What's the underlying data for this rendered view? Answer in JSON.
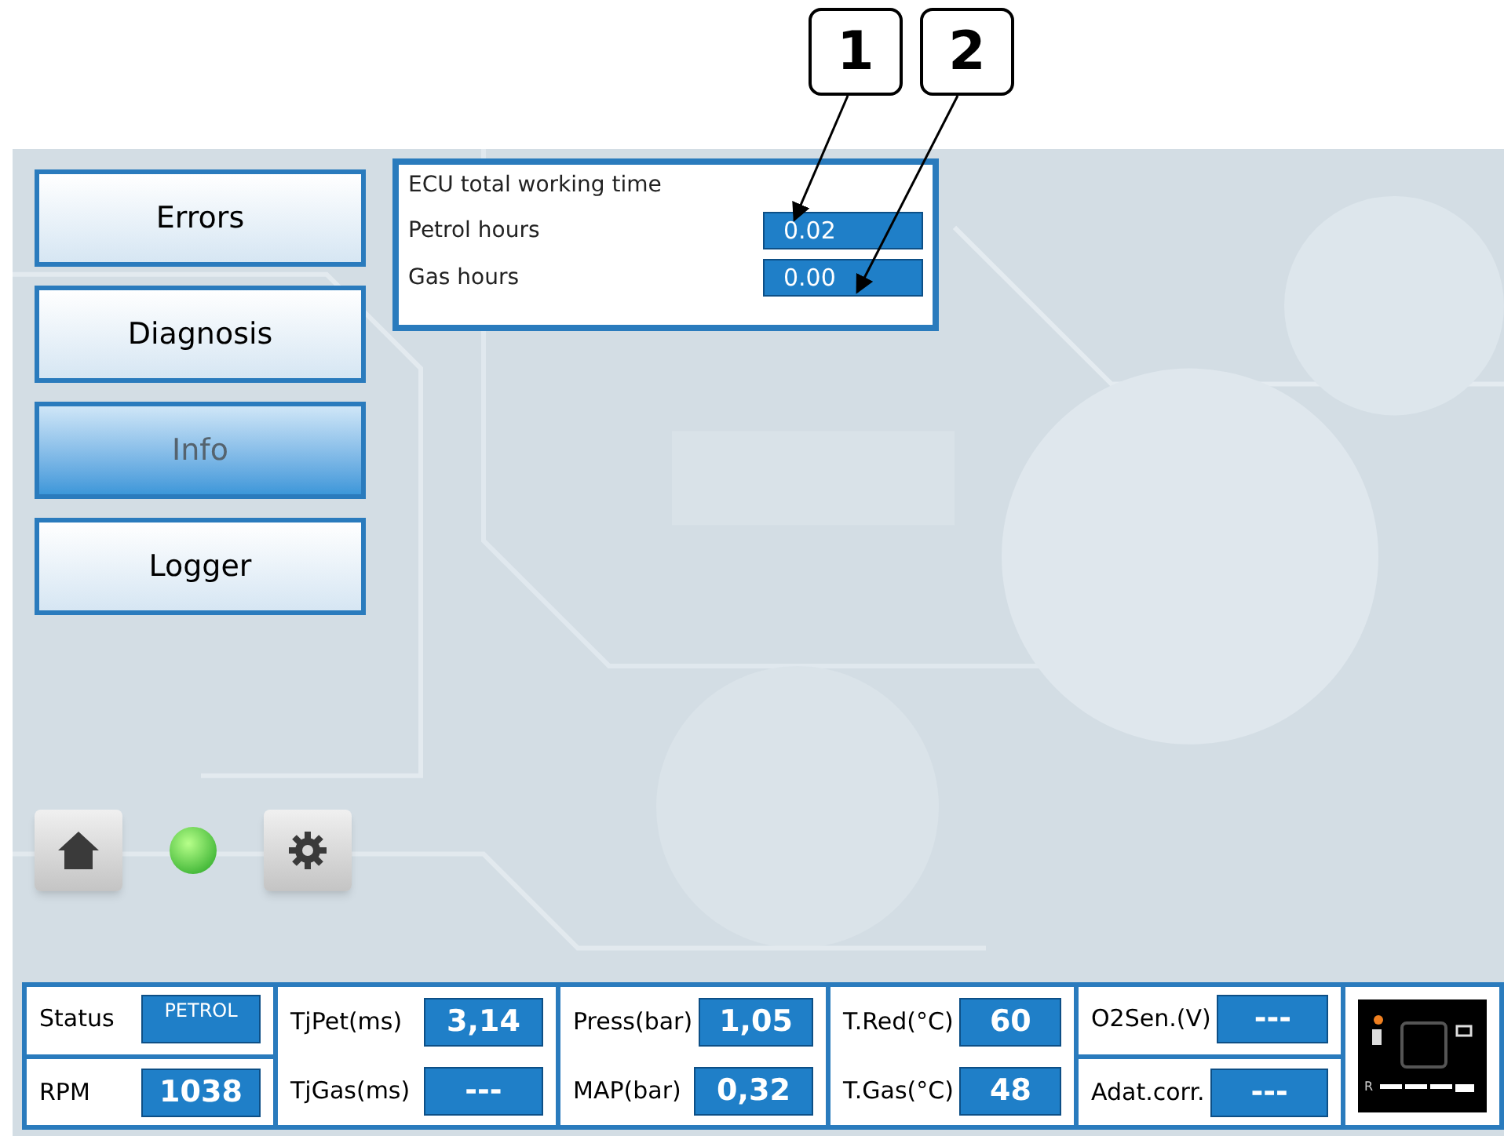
{
  "callouts": [
    {
      "label": "1"
    },
    {
      "label": "2"
    }
  ],
  "nav": [
    {
      "label": "Errors",
      "selected": false
    },
    {
      "label": "Diagnosis",
      "selected": false
    },
    {
      "label": "Info",
      "selected": true
    },
    {
      "label": "Logger",
      "selected": false
    }
  ],
  "info_panel": {
    "title": "ECU total working time",
    "rows": [
      {
        "label": "Petrol hours",
        "value": "0.02"
      },
      {
        "label": "Gas hours",
        "value": "0.00"
      }
    ]
  },
  "status_led": {
    "on": true
  },
  "readouts": [
    [
      {
        "label": "Status",
        "value": "PETROL",
        "kind": "status"
      },
      {
        "label": "RPM",
        "value": "1038",
        "kind": "number"
      }
    ],
    [
      {
        "label": "TjPet(ms)",
        "value": "3,14",
        "kind": "number"
      },
      {
        "label": "TjGas(ms)",
        "value": "---",
        "kind": "number"
      }
    ],
    [
      {
        "label": "Press(bar)",
        "value": "1,05",
        "kind": "number"
      },
      {
        "label": "MAP(bar)",
        "value": "0,32",
        "kind": "number"
      }
    ],
    [
      {
        "label": "T.Red(°C)",
        "value": "60",
        "kind": "number"
      },
      {
        "label": "T.Gas(°C)",
        "value": "48",
        "kind": "number"
      }
    ],
    [
      {
        "label": "O2Sen.(V)",
        "value": "---",
        "kind": "number"
      },
      {
        "label": "Adat.corr.",
        "value": "---",
        "kind": "number"
      }
    ]
  ],
  "switch_panel": {
    "reverse_label": "R"
  }
}
